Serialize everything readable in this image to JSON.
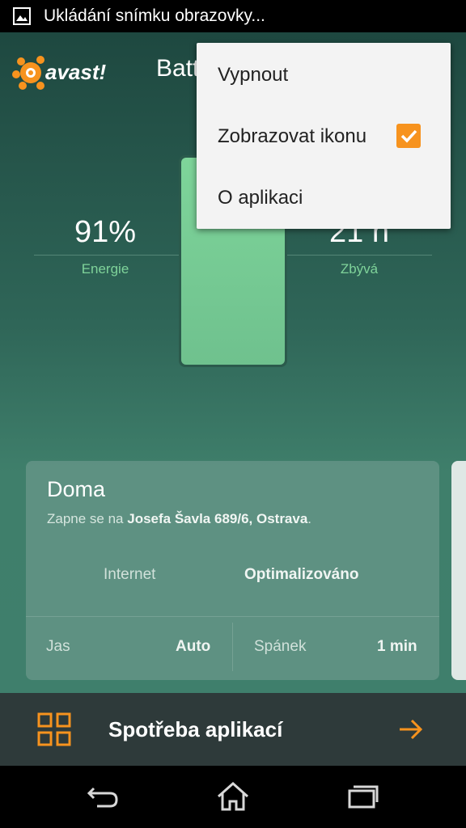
{
  "status_bar": {
    "notification_text": "Ukládání snímku obrazovky..."
  },
  "header": {
    "logo_text": "avast!",
    "title": "Batt"
  },
  "stats": {
    "energy_value": "91%",
    "energy_label": "Energie",
    "remaining_value": "21 h",
    "remaining_label": "Zbývá"
  },
  "battery": {
    "level_percent": 91
  },
  "profile_card": {
    "title": "Doma",
    "subtitle_prefix": "Zapne se na ",
    "subtitle_address": "Josefa Šavla 689/6, Ostrava",
    "subtitle_suffix": ".",
    "internet_label": "Internet",
    "internet_value": "Optimalizováno",
    "brightness_label": "Jas",
    "brightness_value": "Auto",
    "sleep_label": "Spánek",
    "sleep_value": "1 min"
  },
  "bottom_bar": {
    "label": "Spotřeba aplikací"
  },
  "overflow_menu": {
    "items": [
      {
        "label": "Vypnout"
      },
      {
        "label": "Zobrazovat ikonu",
        "checked": true
      },
      {
        "label": "O aplikaci"
      }
    ]
  },
  "colors": {
    "accent": "#f7931e",
    "green_label": "#7fd39a",
    "battery_fill": "#7ed59a"
  }
}
